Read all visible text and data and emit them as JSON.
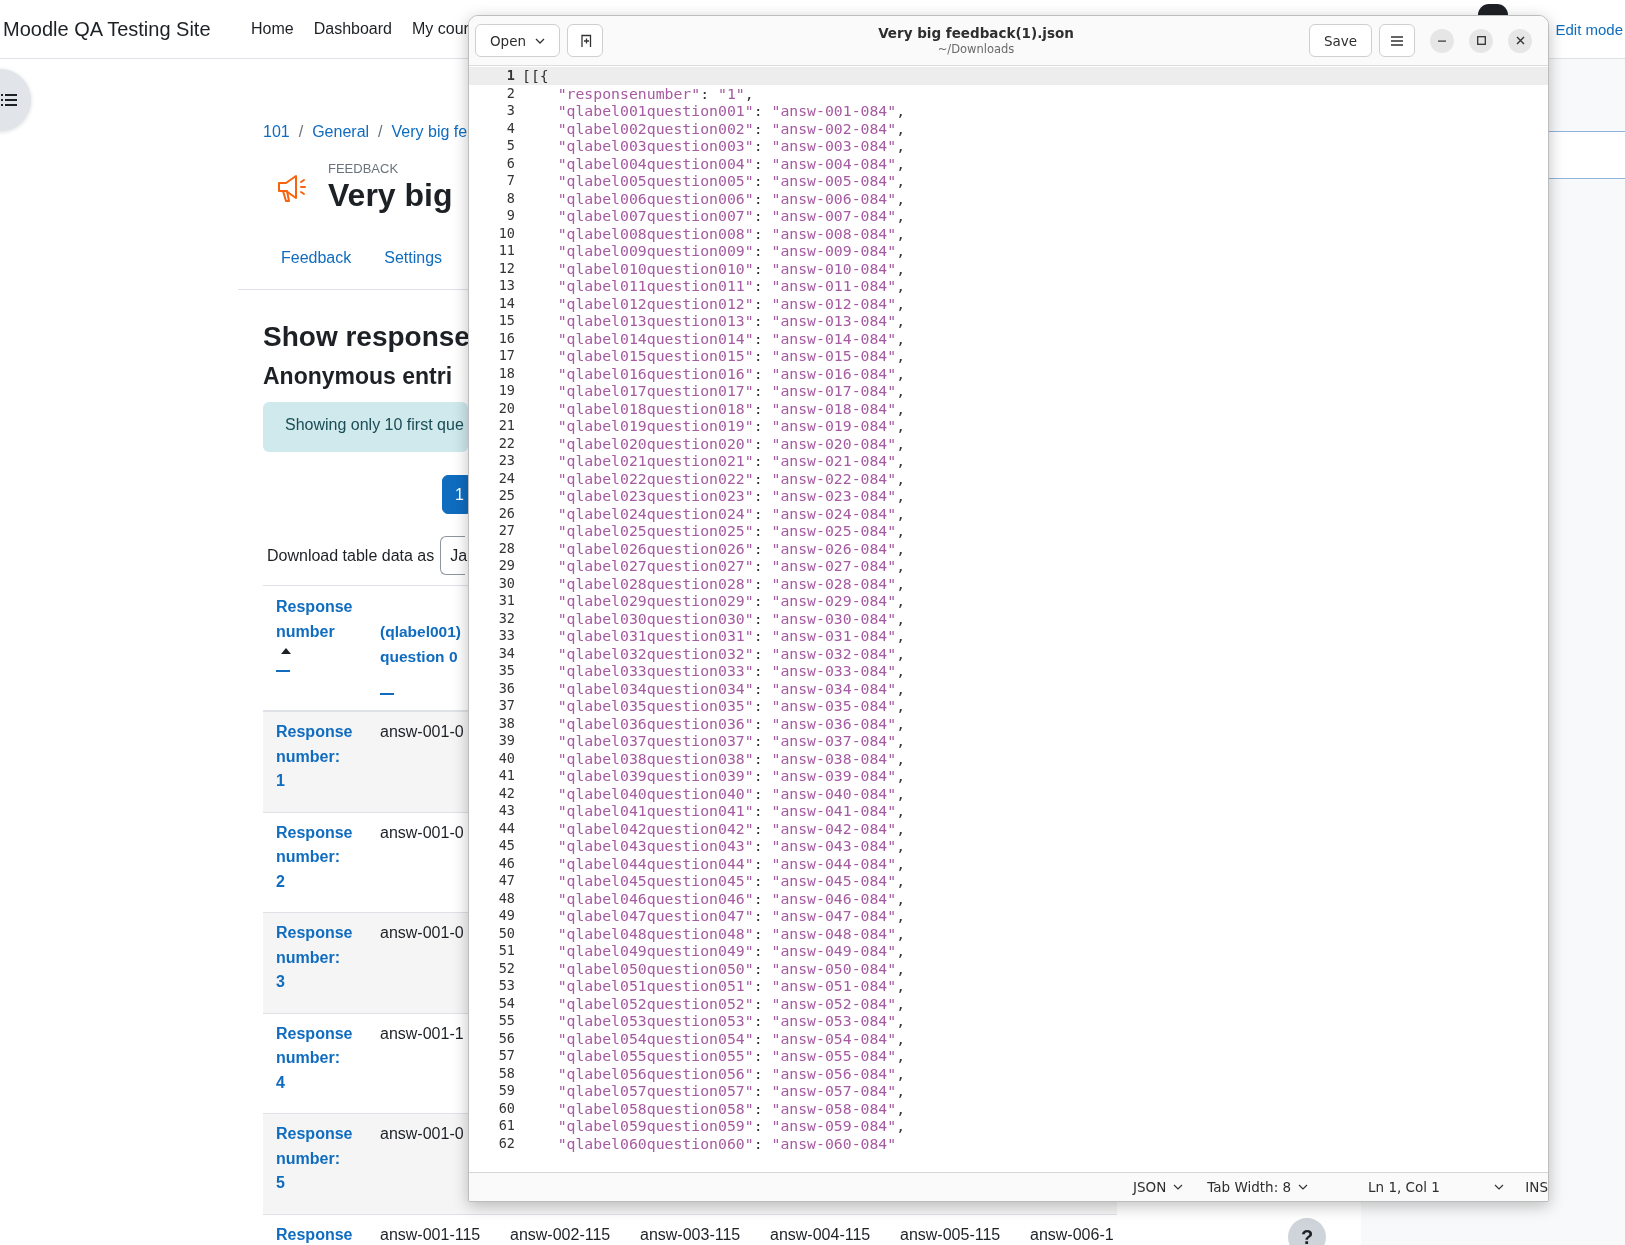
{
  "browser_page": {
    "navbar": {
      "site_name": "Moodle QA Testing Site",
      "links": [
        "Home",
        "Dashboard",
        "My cour"
      ],
      "edit_mode_label": "Edit mode"
    },
    "breadcrumb": [
      "101",
      "General",
      "Very big fe"
    ],
    "breadcrumb_separator": "/",
    "activity_type": "FEEDBACK",
    "page_title": "Very big",
    "tabs": [
      {
        "label": "Feedback",
        "selected": false
      },
      {
        "label": "Settings",
        "selected": false
      }
    ],
    "heading": "Show response",
    "subheading": "Anonymous entri",
    "notice": "Showing only 10 first que",
    "pagination": [
      {
        "label": "1",
        "selected": true
      }
    ],
    "download": {
      "label": "Download table data as",
      "select_value": "Ja"
    },
    "table": {
      "columns": [
        {
          "label": "Response number",
          "sorted_ascending": true
        },
        {
          "label": "(qlabel001) question 0",
          "sorted_ascending": false
        }
      ],
      "rows": [
        {
          "cells": [
            "Response number: 1",
            "answ-001-0"
          ]
        },
        {
          "cells": [
            "Response number: 2",
            "answ-001-0"
          ]
        },
        {
          "cells": [
            "Response number: 3",
            "answ-001-0"
          ]
        },
        {
          "cells": [
            "Response number: 4",
            "answ-001-1"
          ]
        },
        {
          "cells": [
            "Response number: 5",
            "answ-001-0"
          ]
        },
        {
          "cells": [
            "Response",
            "answ-001-115",
            "answ-002-115",
            "answ-003-115",
            "answ-004-115",
            "answ-005-115",
            "answ-006-1"
          ]
        }
      ]
    },
    "help_button": "?"
  },
  "editor": {
    "open_button": "Open",
    "title": "Very big feedback(1).json",
    "subtitle": "~/Downloads",
    "save_button": "Save",
    "lines": [
      {
        "number": "1",
        "text": "[[{",
        "current": true
      },
      {
        "number": "2",
        "text": "    \"responsenumber\": \"1\",",
        "current": false
      },
      {
        "number": "3",
        "text": "    \"qlabel001question001\": \"answ-001-084\",",
        "current": false
      },
      {
        "number": "4",
        "text": "    \"qlabel002question002\": \"answ-002-084\",",
        "current": false
      },
      {
        "number": "5",
        "text": "    \"qlabel003question003\": \"answ-003-084\",",
        "current": false
      },
      {
        "number": "6",
        "text": "    \"qlabel004question004\": \"answ-004-084\",",
        "current": false
      },
      {
        "number": "7",
        "text": "    \"qlabel005question005\": \"answ-005-084\",",
        "current": false
      },
      {
        "number": "8",
        "text": "    \"qlabel006question006\": \"answ-006-084\",",
        "current": false
      },
      {
        "number": "9",
        "text": "    \"qlabel007question007\": \"answ-007-084\",",
        "current": false
      },
      {
        "number": "10",
        "text": "    \"qlabel008question008\": \"answ-008-084\",",
        "current": false
      },
      {
        "number": "11",
        "text": "    \"qlabel009question009\": \"answ-009-084\",",
        "current": false
      },
      {
        "number": "12",
        "text": "    \"qlabel010question010\": \"answ-010-084\",",
        "current": false
      },
      {
        "number": "13",
        "text": "    \"qlabel011question011\": \"answ-011-084\",",
        "current": false
      },
      {
        "number": "14",
        "text": "    \"qlabel012question012\": \"answ-012-084\",",
        "current": false
      },
      {
        "number": "15",
        "text": "    \"qlabel013question013\": \"answ-013-084\",",
        "current": false
      },
      {
        "number": "16",
        "text": "    \"qlabel014question014\": \"answ-014-084\",",
        "current": false
      },
      {
        "number": "17",
        "text": "    \"qlabel015question015\": \"answ-015-084\",",
        "current": false
      },
      {
        "number": "18",
        "text": "    \"qlabel016question016\": \"answ-016-084\",",
        "current": false
      },
      {
        "number": "19",
        "text": "    \"qlabel017question017\": \"answ-017-084\",",
        "current": false
      },
      {
        "number": "20",
        "text": "    \"qlabel018question018\": \"answ-018-084\",",
        "current": false
      },
      {
        "number": "21",
        "text": "    \"qlabel019question019\": \"answ-019-084\",",
        "current": false
      },
      {
        "number": "22",
        "text": "    \"qlabel020question020\": \"answ-020-084\",",
        "current": false
      },
      {
        "number": "23",
        "text": "    \"qlabel021question021\": \"answ-021-084\",",
        "current": false
      },
      {
        "number": "24",
        "text": "    \"qlabel022question022\": \"answ-022-084\",",
        "current": false
      },
      {
        "number": "25",
        "text": "    \"qlabel023question023\": \"answ-023-084\",",
        "current": false
      },
      {
        "number": "26",
        "text": "    \"qlabel024question024\": \"answ-024-084\",",
        "current": false
      },
      {
        "number": "27",
        "text": "    \"qlabel025question025\": \"answ-025-084\",",
        "current": false
      },
      {
        "number": "28",
        "text": "    \"qlabel026question026\": \"answ-026-084\",",
        "current": false
      },
      {
        "number": "29",
        "text": "    \"qlabel027question027\": \"answ-027-084\",",
        "current": false
      },
      {
        "number": "30",
        "text": "    \"qlabel028question028\": \"answ-028-084\",",
        "current": false
      },
      {
        "number": "31",
        "text": "    \"qlabel029question029\": \"answ-029-084\",",
        "current": false
      },
      {
        "number": "32",
        "text": "    \"qlabel030question030\": \"answ-030-084\",",
        "current": false
      },
      {
        "number": "33",
        "text": "    \"qlabel031question031\": \"answ-031-084\",",
        "current": false
      },
      {
        "number": "34",
        "text": "    \"qlabel032question032\": \"answ-032-084\",",
        "current": false
      },
      {
        "number": "35",
        "text": "    \"qlabel033question033\": \"answ-033-084\",",
        "current": false
      },
      {
        "number": "36",
        "text": "    \"qlabel034question034\": \"answ-034-084\",",
        "current": false
      },
      {
        "number": "37",
        "text": "    \"qlabel035question035\": \"answ-035-084\",",
        "current": false
      },
      {
        "number": "38",
        "text": "    \"qlabel036question036\": \"answ-036-084\",",
        "current": false
      },
      {
        "number": "39",
        "text": "    \"qlabel037question037\": \"answ-037-084\",",
        "current": false
      },
      {
        "number": "40",
        "text": "    \"qlabel038question038\": \"answ-038-084\",",
        "current": false
      },
      {
        "number": "41",
        "text": "    \"qlabel039question039\": \"answ-039-084\",",
        "current": false
      },
      {
        "number": "42",
        "text": "    \"qlabel040question040\": \"answ-040-084\",",
        "current": false
      },
      {
        "number": "43",
        "text": "    \"qlabel041question041\": \"answ-041-084\",",
        "current": false
      },
      {
        "number": "44",
        "text": "    \"qlabel042question042\": \"answ-042-084\",",
        "current": false
      },
      {
        "number": "45",
        "text": "    \"qlabel043question043\": \"answ-043-084\",",
        "current": false
      },
      {
        "number": "46",
        "text": "    \"qlabel044question044\": \"answ-044-084\",",
        "current": false
      },
      {
        "number": "47",
        "text": "    \"qlabel045question045\": \"answ-045-084\",",
        "current": false
      },
      {
        "number": "48",
        "text": "    \"qlabel046question046\": \"answ-046-084\",",
        "current": false
      },
      {
        "number": "49",
        "text": "    \"qlabel047question047\": \"answ-047-084\",",
        "current": false
      },
      {
        "number": "50",
        "text": "    \"qlabel048question048\": \"answ-048-084\",",
        "current": false
      },
      {
        "number": "51",
        "text": "    \"qlabel049question049\": \"answ-049-084\",",
        "current": false
      },
      {
        "number": "52",
        "text": "    \"qlabel050question050\": \"answ-050-084\",",
        "current": false
      },
      {
        "number": "53",
        "text": "    \"qlabel051question051\": \"answ-051-084\",",
        "current": false
      },
      {
        "number": "54",
        "text": "    \"qlabel052question052\": \"answ-052-084\",",
        "current": false
      },
      {
        "number": "55",
        "text": "    \"qlabel053question053\": \"answ-053-084\",",
        "current": false
      },
      {
        "number": "56",
        "text": "    \"qlabel054question054\": \"answ-054-084\",",
        "current": false
      },
      {
        "number": "57",
        "text": "    \"qlabel055question055\": \"answ-055-084\",",
        "current": false
      },
      {
        "number": "58",
        "text": "    \"qlabel056question056\": \"answ-056-084\",",
        "current": false
      },
      {
        "number": "59",
        "text": "    \"qlabel057question057\": \"answ-057-084\",",
        "current": false
      },
      {
        "number": "60",
        "text": "    \"qlabel058question058\": \"answ-058-084\",",
        "current": false
      },
      {
        "number": "61",
        "text": "    \"qlabel059question059\": \"answ-059-084\",",
        "current": false
      },
      {
        "number": "62",
        "text": "    \"qlabel060question060\": \"answ-060-084\"",
        "current": false
      }
    ],
    "status_bar": {
      "language": "JSON",
      "tab_width": "Tab Width: 8",
      "position": "Ln 1, Col 1",
      "mode": "INS"
    }
  }
}
